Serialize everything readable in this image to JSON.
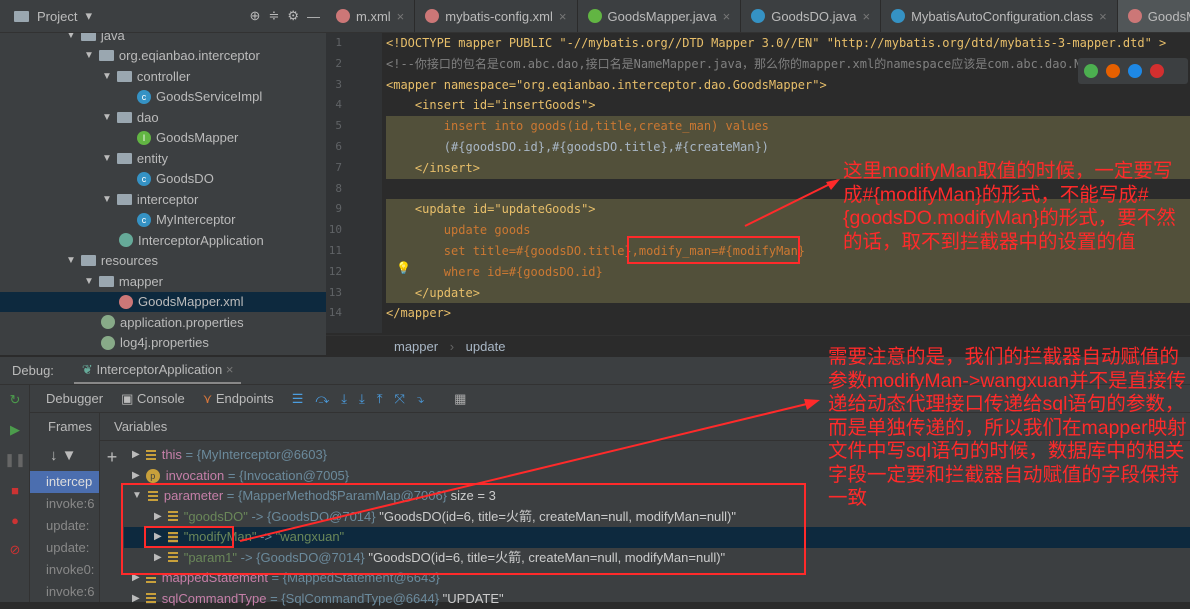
{
  "project": {
    "label": "Project",
    "icons": [
      "target-icon",
      "collapse-icon",
      "gear-icon"
    ]
  },
  "tabs": [
    {
      "label": "m.xml"
    },
    {
      "label": "mybatis-config.xml"
    },
    {
      "label": "GoodsMapper.java"
    },
    {
      "label": "GoodsDO.java"
    },
    {
      "label": "MybatisAutoConfiguration.class"
    },
    {
      "label": "GoodsMapp",
      "active": true
    }
  ],
  "tree": [
    {
      "label": "java",
      "depth": 0,
      "type": "folder"
    },
    {
      "label": "org.eqianbao.interceptor",
      "depth": 1,
      "type": "folder"
    },
    {
      "label": "controller",
      "depth": 2,
      "type": "folder"
    },
    {
      "label": "GoodsServiceImpl",
      "depth": 3,
      "type": "class"
    },
    {
      "label": "dao",
      "depth": 2,
      "type": "folder"
    },
    {
      "label": "GoodsMapper",
      "depth": 3,
      "type": "interface"
    },
    {
      "label": "entity",
      "depth": 2,
      "type": "folder"
    },
    {
      "label": "GoodsDO",
      "depth": 3,
      "type": "class"
    },
    {
      "label": "interceptor",
      "depth": 2,
      "type": "folder"
    },
    {
      "label": "MyInterceptor",
      "depth": 3,
      "type": "class"
    },
    {
      "label": "InterceptorApplication",
      "depth": 2,
      "type": "spring"
    },
    {
      "label": "resources",
      "depth": 0,
      "type": "folder"
    },
    {
      "label": "mapper",
      "depth": 1,
      "type": "folder"
    },
    {
      "label": "GoodsMapper.xml",
      "depth": 2,
      "type": "xml",
      "selected": true
    },
    {
      "label": "application.properties",
      "depth": 1,
      "type": "props"
    },
    {
      "label": "log4j.properties",
      "depth": 1,
      "type": "props"
    }
  ],
  "code": [
    {
      "n": "1",
      "t": "<!DOCTYPE mapper PUBLIC \"-//mybatis.org//DTD Mapper 3.0//EN\" \"http://mybatis.org/dtd/mybatis-3-mapper.dtd\" >",
      "c": "tag"
    },
    {
      "n": "2",
      "t": "<!--你接口的包名是com.abc.dao,接口名是NameMapper.java，那么你的mapper.xml的namespace应该是com.abc.dao.NameMapper-->",
      "c": "cm"
    },
    {
      "n": "3",
      "t": "<mapper namespace=\"org.eqianbao.interceptor.dao.GoodsMapper\">",
      "c": "tag"
    },
    {
      "n": "4",
      "t": "    <insert id=\"insertGoods\">",
      "c": "tag"
    },
    {
      "n": "5",
      "t": "        insert into goods(id,title,create_man) values",
      "c": "kw",
      "hl": true
    },
    {
      "n": "6",
      "t": "        (#{goodsDO.id},#{goodsDO.title},#{createMan})",
      "c": "plain",
      "hl": true
    },
    {
      "n": "7",
      "t": "    </insert>",
      "c": "tag",
      "hl": true
    },
    {
      "n": "8",
      "t": "",
      "c": "plain"
    },
    {
      "n": "9",
      "t": "    <update id=\"updateGoods\">",
      "c": "tag",
      "hl": true
    },
    {
      "n": "10",
      "t": "        update goods",
      "c": "kw",
      "hl": true
    },
    {
      "n": "11",
      "t": "        set title=#{goodsDO.title},modify_man=#{modifyMan}",
      "c": "kw",
      "hl": true
    },
    {
      "n": "12",
      "t": "        where id=#{goodsDO.id}",
      "c": "kw",
      "hl": true
    },
    {
      "n": "13",
      "t": "    </update>",
      "c": "tag",
      "hl": true
    },
    {
      "n": "14",
      "t": "</mapper>",
      "c": "tag"
    }
  ],
  "breadcrumb": [
    "mapper",
    "update"
  ],
  "debug": {
    "label": "Debug:",
    "config": "InterceptorApplication",
    "tabs": [
      "Debugger",
      "Console",
      "Endpoints"
    ],
    "frames_label": "Frames",
    "variables_label": "Variables",
    "frames": [
      "intercep",
      "invoke:6",
      "update:",
      "update:",
      "invoke0:",
      "invoke:6"
    ],
    "variables": [
      {
        "depth": 0,
        "name": "this",
        "val": " = {MyInterceptor@6603}",
        "icon": "field"
      },
      {
        "depth": 0,
        "name": "invocation",
        "val": " = {Invocation@7005}",
        "icon": "param"
      },
      {
        "depth": 0,
        "name": "parameter",
        "val": " = {MapperMethod$ParamMap@7006}",
        "extra": "  size = 3",
        "expanded": true
      },
      {
        "depth": 1,
        "name": "\"goodsDO\"",
        "val": " -> {GoodsDO@7014}",
        "extra": " \"GoodsDO(id=6, title=火箭, createMan=null, modifyMan=null)\"",
        "str": true
      },
      {
        "depth": 1,
        "name": "\"modifyMan\"",
        "val": " -> ",
        "extra2": "\"wangxuan\"",
        "str": true,
        "selected": true
      },
      {
        "depth": 1,
        "name": "\"param1\"",
        "val": " -> {GoodsDO@7014}",
        "extra": " \"GoodsDO(id=6, title=火箭, createMan=null, modifyMan=null)\"",
        "str": true
      },
      {
        "depth": 0,
        "name": "mappedStatement",
        "val": " = {MappedStatement@6643}"
      },
      {
        "depth": 0,
        "name": "sqlCommandType",
        "val": " = {SqlCommandType@6644}",
        "extra": " \"UPDATE\""
      }
    ]
  },
  "annotations": {
    "note1": "这里modifyMan取值的时候，一定要写成#{modifyMan}的形式，不能写成#{goodsDO.modifyMan}的形式，要不然的话，取不到拦截器中的设置的值",
    "note2": "需要注意的是，我们的拦截器自动赋值的参数modifyMan->wangxuan并不是直接传递给动态代理接口传递给sql语句的参数，而是单独传递的，所以我们在mapper映射文件中写sql语句的时候，数据库中的相关字段一定要和拦截器自动赋值的字段保持一致"
  },
  "colors": {
    "annotation": "#ff2a2a",
    "highlight": "#52503a",
    "selection": "#0d293e"
  }
}
